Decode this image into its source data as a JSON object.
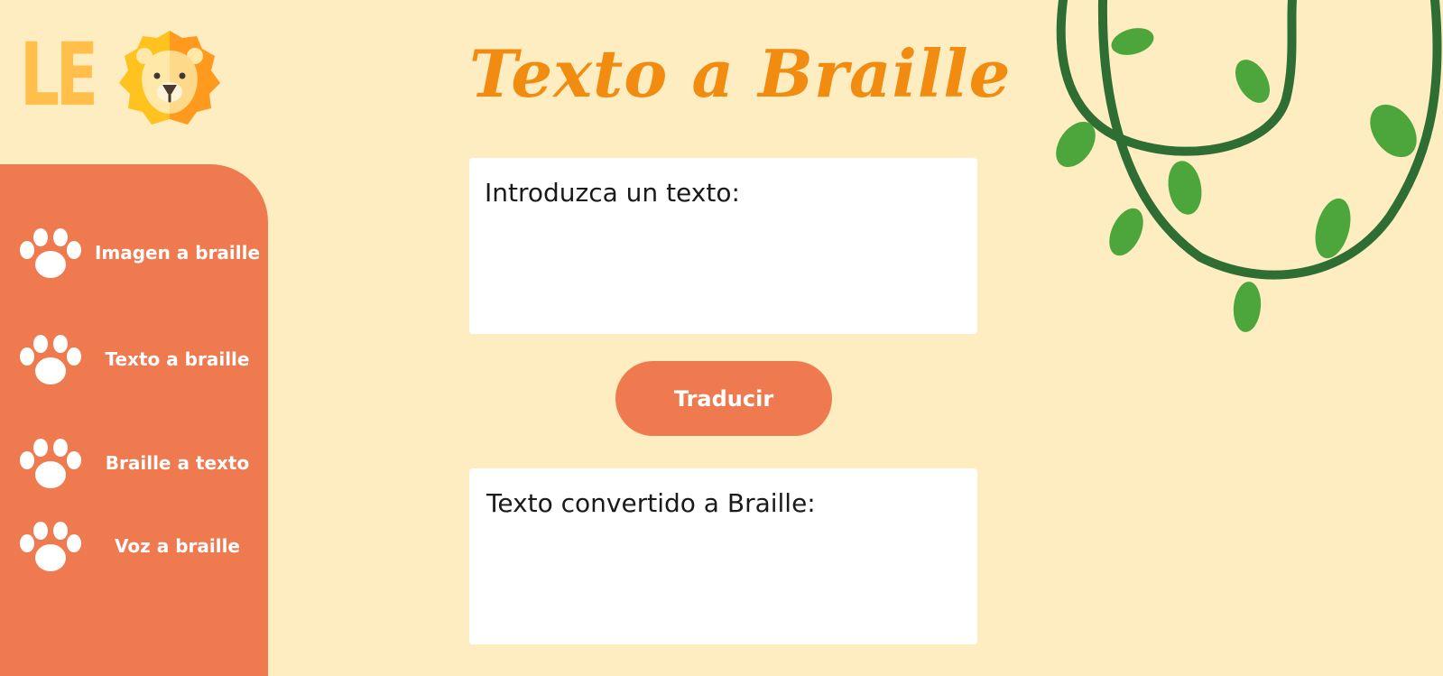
{
  "brand": {
    "logo_text": "LE",
    "logo_icon": "lion-face-icon"
  },
  "page": {
    "title": "Texto a Braille"
  },
  "sidebar": {
    "items": [
      {
        "label": "Imagen a braille",
        "icon": "paw-icon"
      },
      {
        "label": "Texto a braille",
        "icon": "paw-icon"
      },
      {
        "label": "Braille a texto",
        "icon": "paw-icon"
      },
      {
        "label": "Voz a braille",
        "icon": "paw-icon"
      }
    ]
  },
  "input_panel": {
    "label": "Introduzca un texto:",
    "value": ""
  },
  "translate_button": {
    "label": "Traducir"
  },
  "output_panel": {
    "label": "Texto convertido a Braille:",
    "value": ""
  },
  "decoration": {
    "icon": "hanging-vines-icon"
  },
  "colors": {
    "background": "#FEEDC0",
    "sidebar": "#EF7A50",
    "button": "#EF7A50",
    "title": "#F28C11",
    "logo": "#FFBF4A",
    "vine": "#2F6E33",
    "leaf": "#4CA63C"
  }
}
